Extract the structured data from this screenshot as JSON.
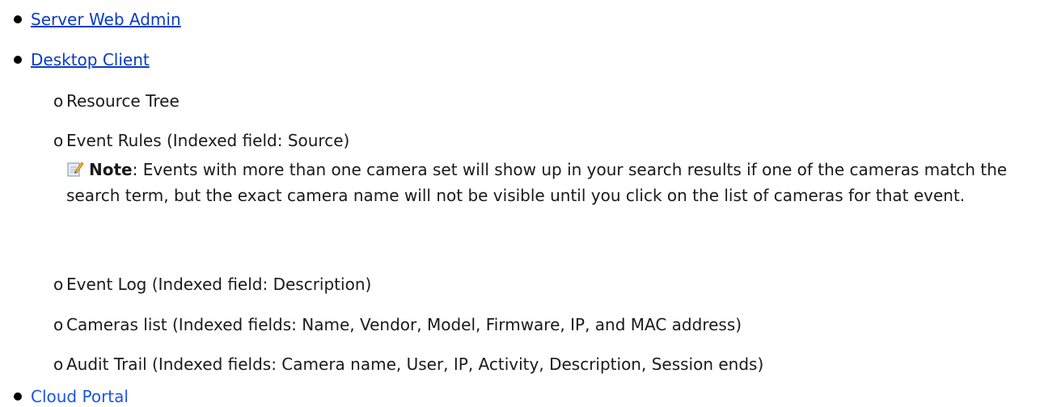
{
  "links": [
    {
      "label": "Server Web Admin"
    },
    {
      "label": "Desktop Client"
    },
    {
      "label": "Cloud Portal"
    }
  ],
  "desktop_client_items": [
    "Resource Tree",
    "Event Rules (Indexed field: Source)",
    "Event Log (Indexed field: Description)",
    "Cameras list (Indexed fields: Name, Vendor, Model, Firmware, IP, and MAC address)",
    "Audit Trail (Indexed fields: Camera name, User, IP, Activity, Description, Session ends)"
  ],
  "sub_bullet_glyph": "o",
  "note": {
    "icon": "note-pencil-icon",
    "label": "Note",
    "text": ": Events with more than one camera set will show up in your search results if one of the cameras match the search term, but the exact camera name will not be visible until you click on the list of cameras for that event."
  }
}
